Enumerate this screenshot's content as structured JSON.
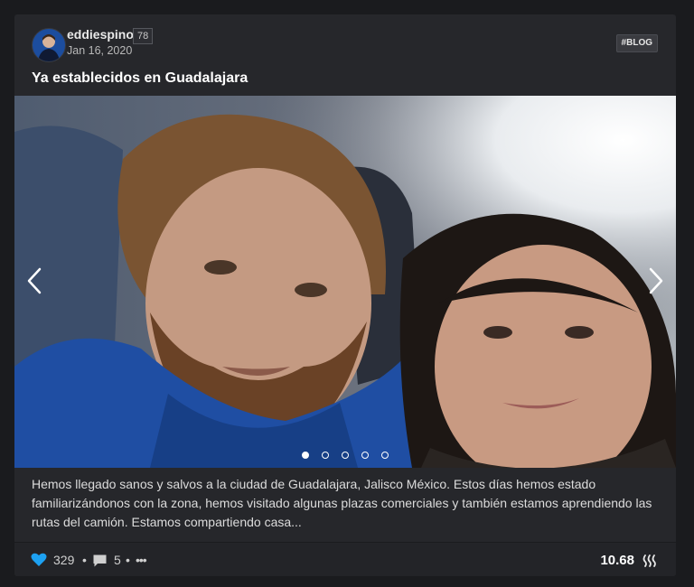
{
  "post": {
    "author": "eddiespino",
    "reputation": "78",
    "date": "Jan 16, 2020",
    "tag": "#BLOG",
    "title": "Ya establecidos en Guadalajara",
    "body": "Hemos llegado sanos y salvos a la ciudad de Guadalajara, Jalisco México. Estos días hemos estado familiarizándonos con la zona, hemos visitado algunas plazas comerciales y también estamos aprendiendo las rutas del camión. Estamos compartiendo casa..."
  },
  "carousel": {
    "slide_count": 5,
    "active_slide": 1
  },
  "footer": {
    "votes": "329",
    "separator": "•",
    "comments": "5",
    "more": "•••",
    "payout": "10.68"
  },
  "colors": {
    "background": "#1a1b1e",
    "card": "#26272b",
    "heart": "#1da1f2",
    "text": "#dcdcdc"
  },
  "icons": [
    "heart-icon",
    "comment-icon",
    "more-icon",
    "steem-icon",
    "chevron-left-icon",
    "chevron-right-icon"
  ]
}
